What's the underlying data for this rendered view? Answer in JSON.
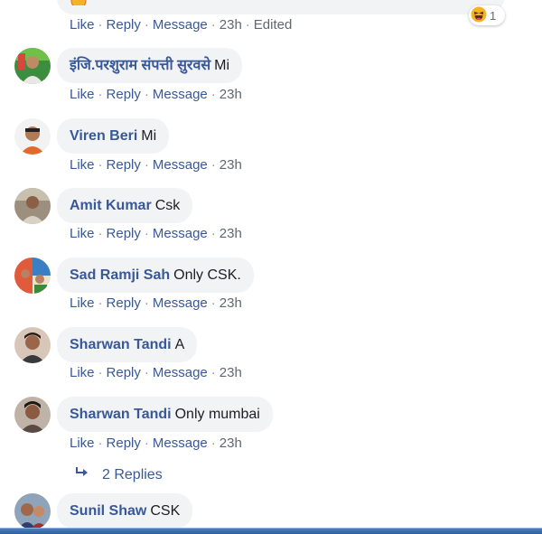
{
  "top_comment": {
    "actions": {
      "like": "Like",
      "reply": "Reply",
      "message": "Message",
      "time": "23h",
      "edited": "Edited"
    },
    "reaction_icon": "laughing-face-icon",
    "reaction_count": "1"
  },
  "comments": [
    {
      "author": "इंजि.परशुराम संपत्ती सुरवसे",
      "text": "Mi",
      "actions": {
        "like": "Like",
        "reply": "Reply",
        "message": "Message",
        "time": "23h"
      },
      "avatar_color": "#2e7d32"
    },
    {
      "author": "Viren Beri",
      "text": "Mi",
      "actions": {
        "like": "Like",
        "reply": "Reply",
        "message": "Message",
        "time": "23h"
      },
      "avatar_color": "#e06a2c"
    },
    {
      "author": "Amit Kumar",
      "text": "Csk",
      "actions": {
        "like": "Like",
        "reply": "Reply",
        "message": "Message",
        "time": "23h"
      },
      "avatar_color": "#8d7a64"
    },
    {
      "author": "Sad Ramji Sah",
      "text": "Only CSK.",
      "actions": {
        "like": "Like",
        "reply": "Reply",
        "message": "Message",
        "time": "23h"
      },
      "avatar_color": "#d84a3a"
    },
    {
      "author": "Sharwan Tandi",
      "text": "A",
      "actions": {
        "like": "Like",
        "reply": "Reply",
        "message": "Message",
        "time": "23h"
      },
      "avatar_color": "#8a5a3c"
    },
    {
      "author": "Sharwan Tandi",
      "text": "Only mumbai",
      "actions": {
        "like": "Like",
        "reply": "Reply",
        "message": "Message",
        "time": "23h"
      },
      "avatar_color": "#5a4a42"
    }
  ],
  "replies_link": {
    "icon": "reply-arrow-icon",
    "label": "2 Replies"
  },
  "last_comment": {
    "author": "Sunil Shaw",
    "text": "CSK",
    "avatar_color": "#a0522d"
  }
}
